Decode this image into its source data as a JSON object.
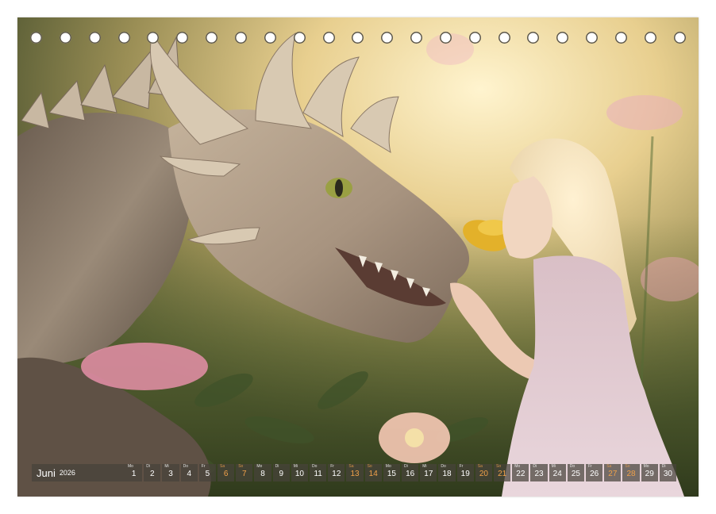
{
  "calendar": {
    "month": "Juni",
    "year": "2026",
    "weekday_labels": [
      "Mo",
      "Di",
      "Mi",
      "Do",
      "Fr",
      "Sa",
      "So"
    ],
    "days": [
      {
        "num": "1",
        "wd": "Mo",
        "weekend": false
      },
      {
        "num": "2",
        "wd": "Di",
        "weekend": false
      },
      {
        "num": "3",
        "wd": "Mi",
        "weekend": false
      },
      {
        "num": "4",
        "wd": "Do",
        "weekend": false
      },
      {
        "num": "5",
        "wd": "Fr",
        "weekend": false
      },
      {
        "num": "6",
        "wd": "Sa",
        "weekend": true
      },
      {
        "num": "7",
        "wd": "So",
        "weekend": true
      },
      {
        "num": "8",
        "wd": "Mo",
        "weekend": false
      },
      {
        "num": "9",
        "wd": "Di",
        "weekend": false
      },
      {
        "num": "10",
        "wd": "Mi",
        "weekend": false
      },
      {
        "num": "11",
        "wd": "Do",
        "weekend": false
      },
      {
        "num": "12",
        "wd": "Fr",
        "weekend": false
      },
      {
        "num": "13",
        "wd": "Sa",
        "weekend": true
      },
      {
        "num": "14",
        "wd": "So",
        "weekend": true
      },
      {
        "num": "15",
        "wd": "Mo",
        "weekend": false
      },
      {
        "num": "16",
        "wd": "Di",
        "weekend": false
      },
      {
        "num": "17",
        "wd": "Mi",
        "weekend": false
      },
      {
        "num": "18",
        "wd": "Do",
        "weekend": false
      },
      {
        "num": "19",
        "wd": "Fr",
        "weekend": false
      },
      {
        "num": "20",
        "wd": "Sa",
        "weekend": true
      },
      {
        "num": "21",
        "wd": "So",
        "weekend": true
      },
      {
        "num": "22",
        "wd": "Mo",
        "weekend": false
      },
      {
        "num": "23",
        "wd": "Di",
        "weekend": false
      },
      {
        "num": "24",
        "wd": "Mi",
        "weekend": false
      },
      {
        "num": "25",
        "wd": "Do",
        "weekend": false
      },
      {
        "num": "26",
        "wd": "Fr",
        "weekend": false
      },
      {
        "num": "27",
        "wd": "Sa",
        "weekend": true
      },
      {
        "num": "28",
        "wd": "So",
        "weekend": true
      },
      {
        "num": "29",
        "wd": "Mo",
        "weekend": false
      },
      {
        "num": "30",
        "wd": "Di",
        "weekend": false
      }
    ],
    "binding_hole_count": 23
  },
  "colors": {
    "weekend_text": "#f0a14a",
    "weekday_text": "#ffffff",
    "strip_background": "#46423a"
  }
}
